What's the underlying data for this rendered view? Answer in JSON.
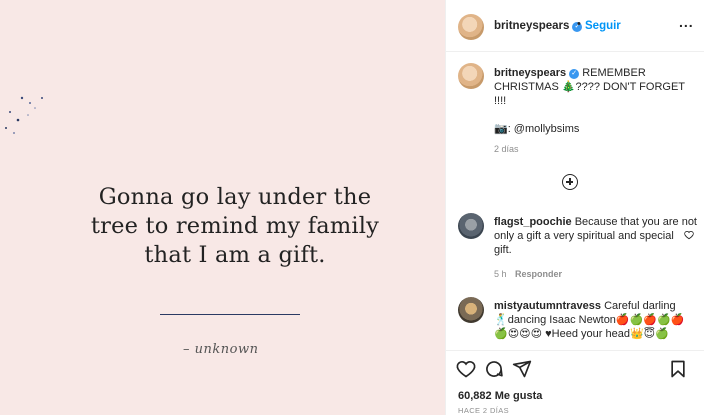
{
  "post": {
    "quote_lines": [
      "Gonna go lay under the",
      "tree to remind my family",
      "that I am a gift."
    ],
    "author": "– unknown"
  },
  "header": {
    "username": "britneyspears",
    "separator": "•",
    "follow_label": "Seguir",
    "more_label": "..."
  },
  "caption": {
    "username": "britneyspears",
    "text_line1": "REMEMBER",
    "text_line2": "CHRISTMAS 🎄???? DON'T FORGET",
    "text_line3": "!!!!",
    "credit": "📷: @mollybsims",
    "time": "2 días"
  },
  "comments": [
    {
      "username": "flagst_poochie",
      "text_line1": "Because that you are not",
      "text_line2": "only a gift a very spiritual and special",
      "text_line3": "gift.",
      "time": "5 h",
      "reply_label": "Responder"
    },
    {
      "username": "mistyautumntravess",
      "text_line1": "Careful darling",
      "text_line2": "🕺dancing Isaac Newton🍎🍏🍎🍏🍎",
      "text_line3": "🍏😍😍😍 ♥Heed your head👑😇🍏"
    }
  ],
  "footer": {
    "likes": "60,882 Me gusta",
    "ago": "HACE 2 DÍAS"
  },
  "colors": {
    "image_bg": "#f8e8e6",
    "accent": "#0095f6",
    "rule": "#2b3a63"
  }
}
